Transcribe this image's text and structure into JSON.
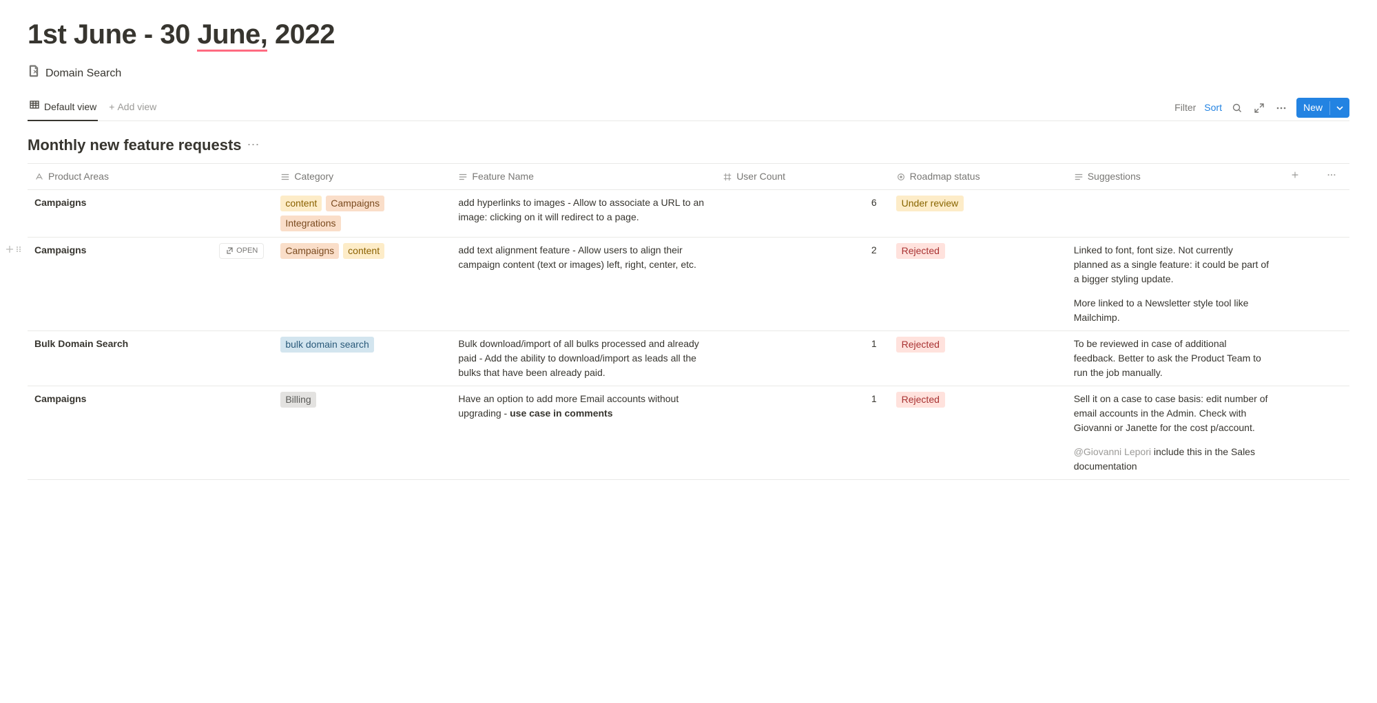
{
  "page": {
    "title_pre": "1st June - 30 ",
    "title_underlined": "June,",
    "title_post": " 2022",
    "linked_db": "Domain Search"
  },
  "views": {
    "active_tab": "Default view",
    "add_view": "Add view"
  },
  "toolbar": {
    "filter": "Filter",
    "sort": "Sort",
    "new": "New"
  },
  "db": {
    "title": "Monthly new feature requests"
  },
  "columns": {
    "product_areas": "Product Areas",
    "category": "Category",
    "feature_name": "Feature Name",
    "user_count": "User Count",
    "roadmap_status": "Roadmap status",
    "suggestions": "Suggestions"
  },
  "tags": {
    "content": "content",
    "campaigns": "Campaigns",
    "integrations": "Integrations",
    "bulk": "bulk domain search",
    "billing": "Billing"
  },
  "status": {
    "under_review": "Under review",
    "rejected": "Rejected"
  },
  "open_label": "OPEN",
  "rows": [
    {
      "product": "Campaigns",
      "feature": "add hyperlinks to images - Allow to associate a URL to an image: clicking on it will redirect to a page.",
      "count": "6",
      "suggestion_p1": "",
      "suggestion_p2": ""
    },
    {
      "product": "Campaigns",
      "feature": "add text alignment feature - Allow users to align their campaign content (text or images) left, right, center, etc.",
      "count": "2",
      "suggestion_p1": "Linked to font, font size. Not currently planned as a single feature: it could be part of a bigger styling update.",
      "suggestion_p2": "More linked to a Newsletter style tool like Mailchimp."
    },
    {
      "product": "Bulk Domain Search",
      "feature": "Bulk download/import of all bulks processed and already paid - Add the ability to download/import as leads all the bulks that have been already paid.",
      "count": "1",
      "suggestion_p1": "To be reviewed in case of additional feedback. Better to ask the Product Team to run the job manually.",
      "suggestion_p2": ""
    },
    {
      "product": "Campaigns",
      "feature_pre": "Have an option to add more Email accounts without upgrading - ",
      "feature_bold": "use case in comments",
      "count": "1",
      "suggestion_p1": "Sell it on a case to case basis: edit number of email accounts in the Admin. Check with Giovanni or Janette for the cost p/account.",
      "mention": "@Giovanni Lepori",
      "suggestion_p2_rest": " include this in the Sales documentation"
    }
  ]
}
